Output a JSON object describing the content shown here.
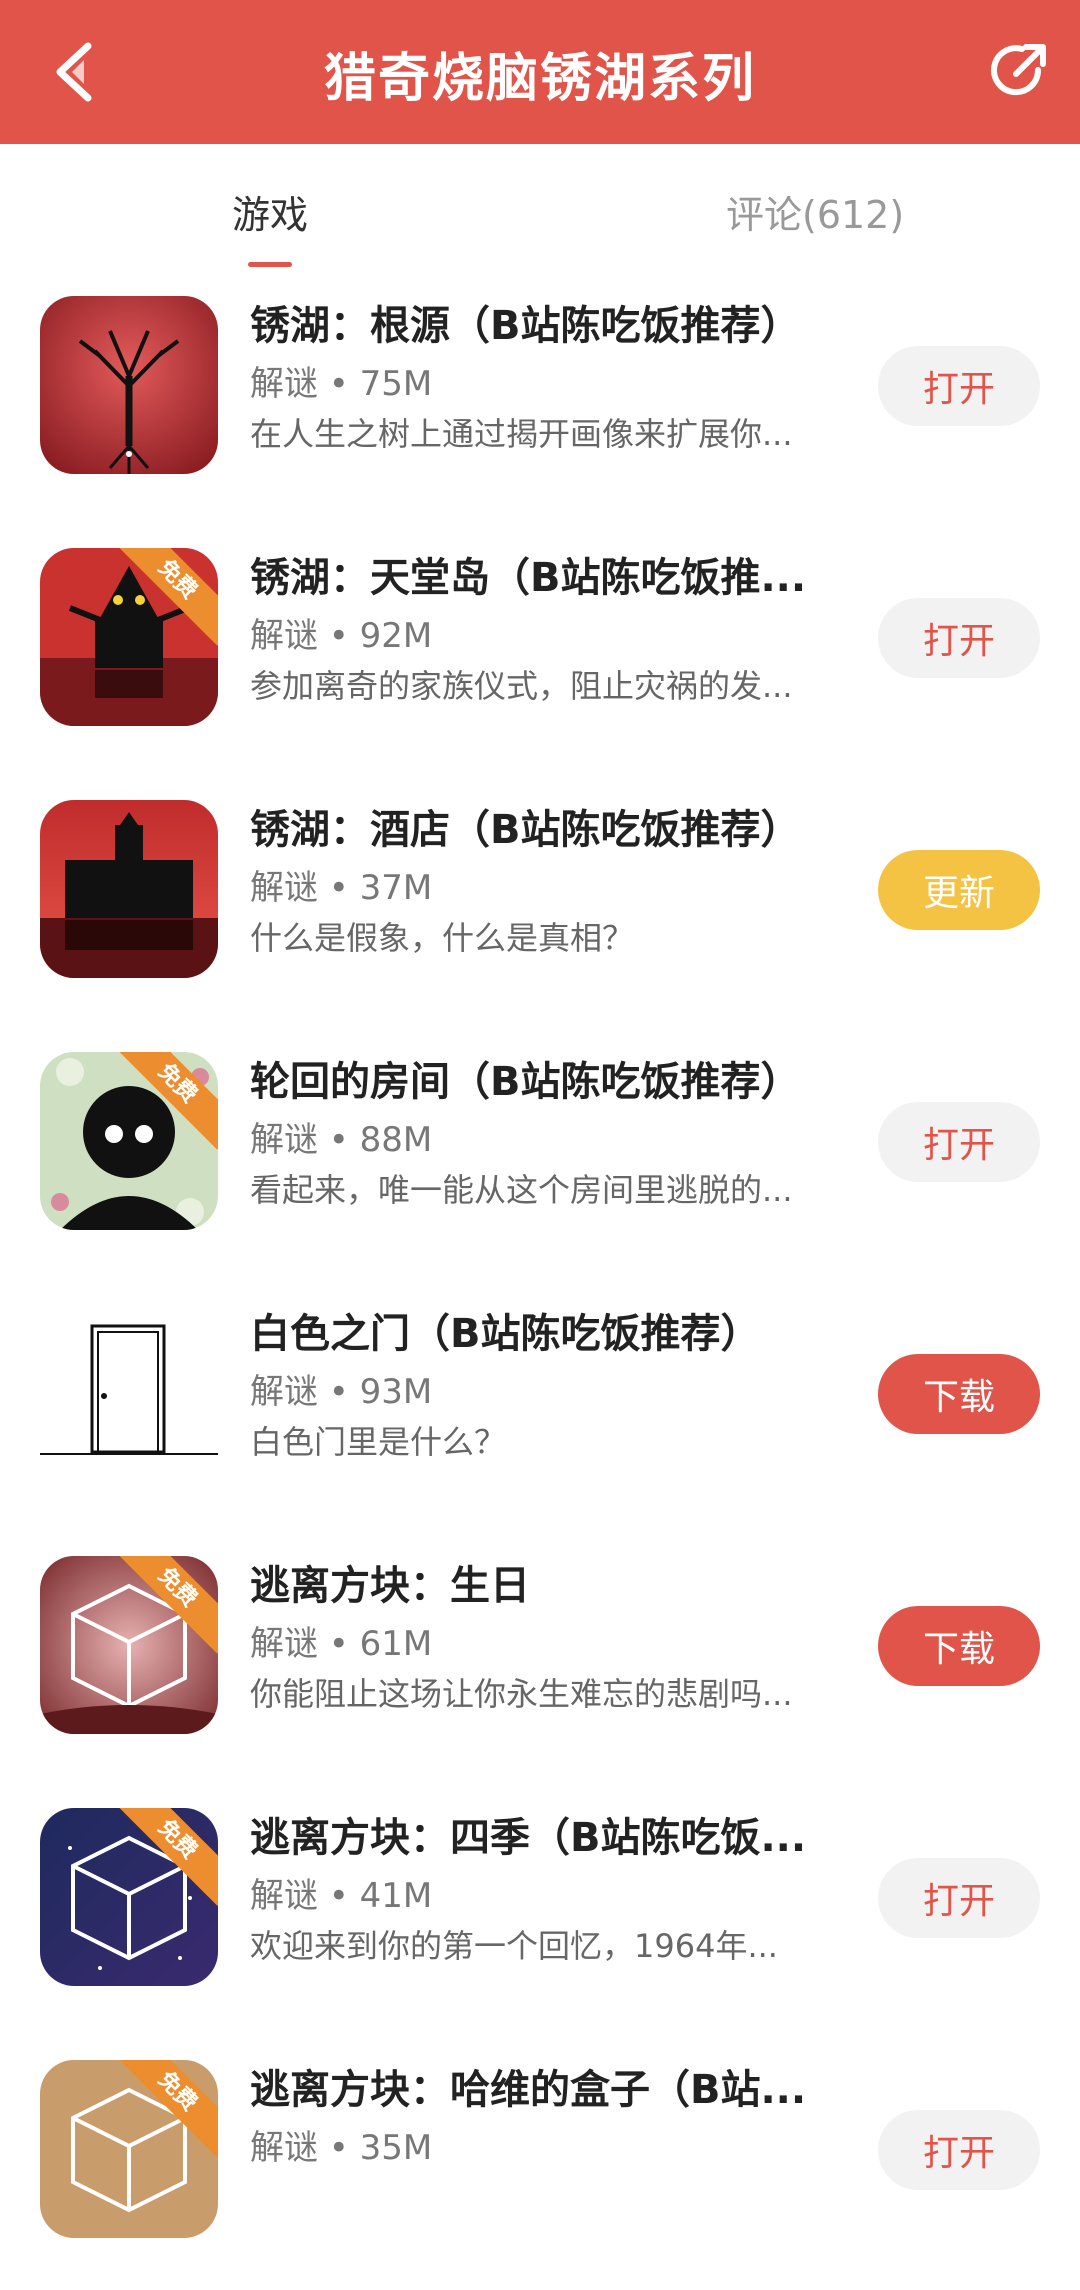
{
  "header": {
    "title": "猎奇烧脑锈湖系列",
    "back_icon": "back-arrow-icon",
    "share_icon": "share-icon"
  },
  "tabs": [
    {
      "label": "游戏"
    },
    {
      "label": "评论(612)"
    }
  ],
  "ribbon_label": "免费",
  "games": [
    {
      "name": "锈湖：根源（B站陈吃饭推荐）",
      "meta": "解谜 • 75M",
      "desc": "在人生之树上通过揭开画像来扩展你...",
      "button": "打开",
      "button_type": "open",
      "free": false
    },
    {
      "name": "锈湖：天堂岛（B站陈吃饭推...",
      "meta": "解谜 • 92M",
      "desc": "参加离奇的家族仪式，阻止灾祸的发...",
      "button": "打开",
      "button_type": "open",
      "free": true
    },
    {
      "name": "锈湖：酒店（B站陈吃饭推荐）",
      "meta": "解谜 • 37M",
      "desc": "什么是假象，什么是真相？",
      "button": "更新",
      "button_type": "update",
      "free": false
    },
    {
      "name": "轮回的房间（B站陈吃饭推荐）",
      "meta": "解谜 • 88M",
      "desc": "看起来，唯一能从这个房间里逃脱的...",
      "button": "打开",
      "button_type": "open",
      "free": true
    },
    {
      "name": "白色之门（B站陈吃饭推荐）",
      "meta": "解谜 • 93M",
      "desc": "白色门里是什么？",
      "button": "下载",
      "button_type": "download",
      "free": false
    },
    {
      "name": "逃离方块：生日",
      "meta": "解谜 • 61M",
      "desc": "你能阻止这场让你永生难忘的悲剧吗...",
      "button": "下载",
      "button_type": "download",
      "free": true
    },
    {
      "name": "逃离方块：四季（B站陈吃饭...",
      "meta": "解谜 • 41M",
      "desc": "欢迎来到你的第一个回忆，1964年...",
      "button": "打开",
      "button_type": "open",
      "free": true
    },
    {
      "name": "逃离方块：哈维的盒子（B站...",
      "meta": "解谜 • 35M",
      "desc": "",
      "button": "打开",
      "button_type": "open",
      "free": true
    }
  ]
}
